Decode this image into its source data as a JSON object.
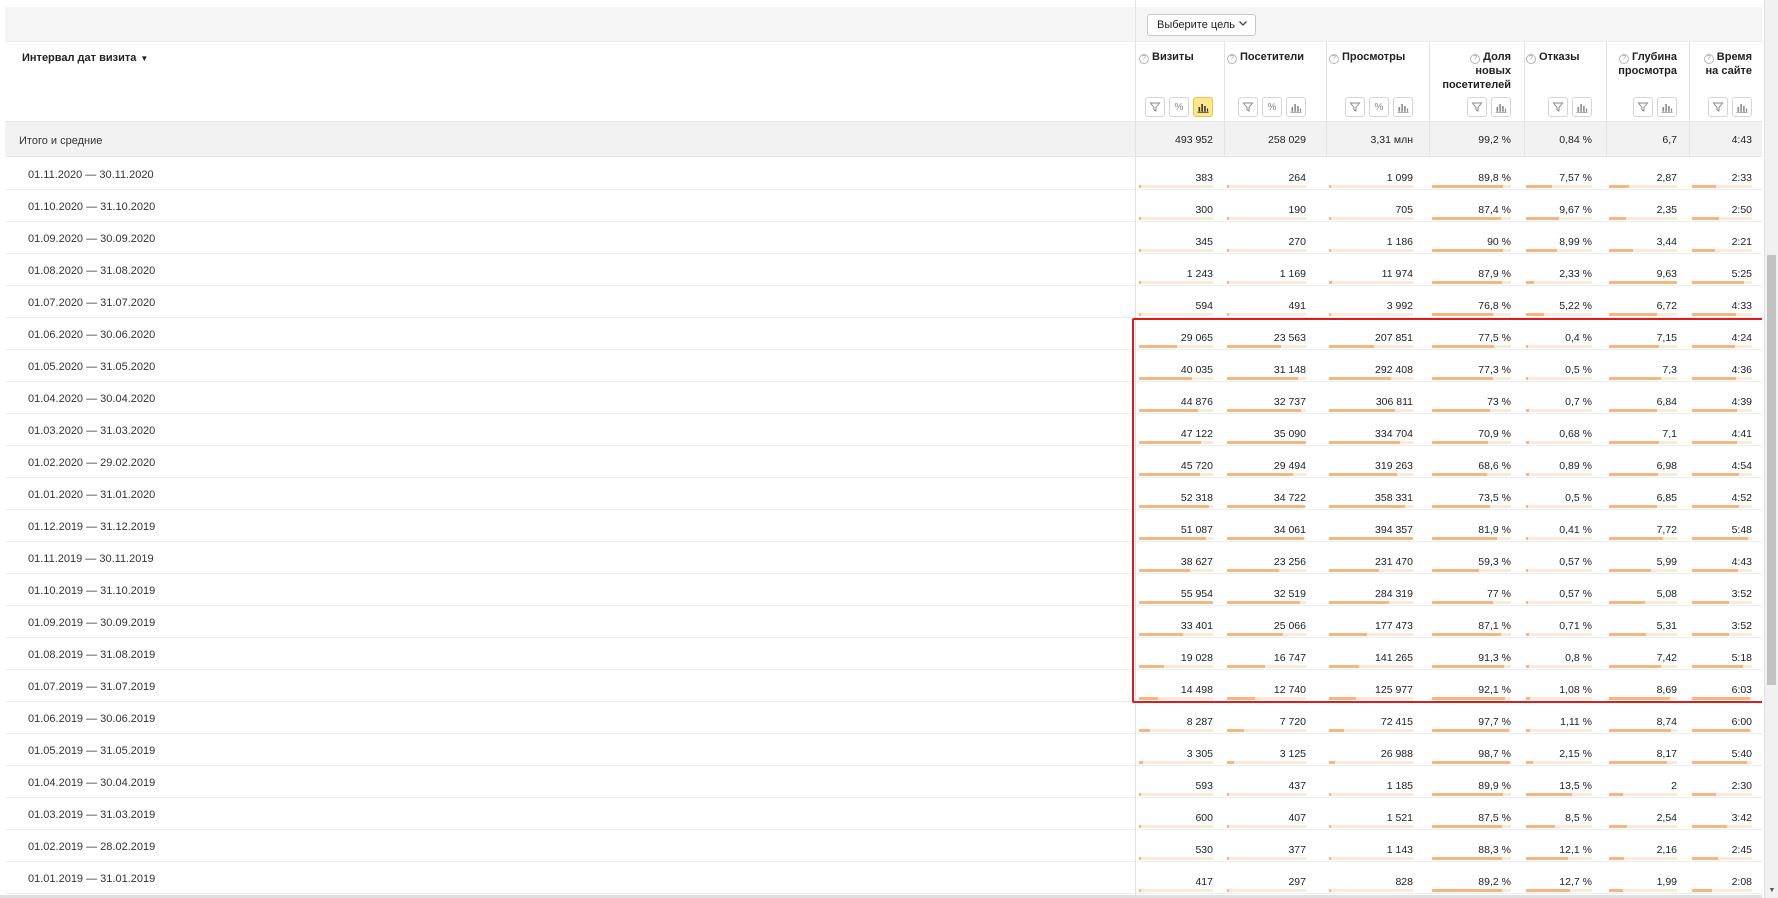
{
  "goal_select": {
    "label": "Выберите цель"
  },
  "header": {
    "dimension_title": "Интервал дат визита",
    "sort_marker": "▼",
    "columns": [
      {
        "key": "visits",
        "lines": [
          "Визиты"
        ],
        "tools": [
          "filter",
          "percent",
          "chart"
        ],
        "chart_active": true
      },
      {
        "key": "visitors",
        "lines": [
          "Посетители"
        ],
        "tools": [
          "filter",
          "percent",
          "chart"
        ],
        "chart_active": false
      },
      {
        "key": "views",
        "lines": [
          "Просмотры"
        ],
        "tools": [
          "filter",
          "percent",
          "chart"
        ],
        "chart_active": false
      },
      {
        "key": "new_share",
        "lines": [
          "Доля",
          "новых",
          "посетителей"
        ],
        "tools": [
          "filter",
          "chart"
        ],
        "chart_active": false
      },
      {
        "key": "bounces",
        "lines": [
          "Отказы"
        ],
        "tools": [
          "filter",
          "chart"
        ],
        "chart_active": false
      },
      {
        "key": "depth",
        "lines": [
          "Глубина",
          "просмотра"
        ],
        "tools": [
          "filter",
          "chart"
        ],
        "chart_active": false
      },
      {
        "key": "time",
        "lines": [
          "Время",
          "на сайте"
        ],
        "tools": [
          "filter",
          "chart"
        ],
        "chart_active": false
      }
    ]
  },
  "totals": {
    "label": "Итого и средние",
    "values": [
      "493 952",
      "258 029",
      "3,31 млн",
      "99,2 %",
      "0,84 %",
      "6,7",
      "4:43"
    ]
  },
  "rows": [
    {
      "period": "01.11.2020 — 30.11.2020",
      "values": [
        "383",
        "264",
        "1 099",
        "89,8 %",
        "7,57 %",
        "2,87",
        "2:33"
      ],
      "bars": [
        0.01,
        0.01,
        0.01,
        0.9,
        0.4,
        0.3,
        0.4
      ]
    },
    {
      "period": "01.10.2020 — 31.10.2020",
      "values": [
        "300",
        "190",
        "705",
        "87,4 %",
        "9,67 %",
        "2,35",
        "2:50"
      ],
      "bars": [
        0.01,
        0.01,
        0.01,
        0.87,
        0.5,
        0.25,
        0.45
      ]
    },
    {
      "period": "01.09.2020 — 30.09.2020",
      "values": [
        "345",
        "270",
        "1 186",
        "90 %",
        "8,99 %",
        "3,44",
        "2:21"
      ],
      "bars": [
        0.01,
        0.01,
        0.01,
        0.9,
        0.47,
        0.36,
        0.38
      ]
    },
    {
      "period": "01.08.2020 — 31.08.2020",
      "values": [
        "1 243",
        "1 169",
        "11 974",
        "87,9 %",
        "2,33 %",
        "9,63",
        "5:25"
      ],
      "bars": [
        0.02,
        0.03,
        0.03,
        0.88,
        0.12,
        1.0,
        0.87
      ]
    },
    {
      "period": "01.07.2020 — 31.07.2020",
      "values": [
        "594",
        "491",
        "3 992",
        "76,8 %",
        "5,22 %",
        "6,72",
        "4:33"
      ],
      "bars": [
        0.01,
        0.01,
        0.01,
        0.77,
        0.28,
        0.7,
        0.73
      ]
    },
    {
      "period": "01.06.2020 — 30.06.2020",
      "values": [
        "29 065",
        "23 563",
        "207 851",
        "77,5 %",
        "0,4 %",
        "7,15",
        "4:24"
      ],
      "bars": [
        0.52,
        0.68,
        0.53,
        0.78,
        0.02,
        0.74,
        0.71
      ]
    },
    {
      "period": "01.05.2020 — 31.05.2020",
      "values": [
        "40 035",
        "31 148",
        "292 408",
        "77,3 %",
        "0,5 %",
        "7,3",
        "4:36"
      ],
      "bars": [
        0.72,
        0.9,
        0.74,
        0.77,
        0.03,
        0.76,
        0.74
      ]
    },
    {
      "period": "01.04.2020 — 30.04.2020",
      "values": [
        "44 876",
        "32 737",
        "306 811",
        "73 %",
        "0,7 %",
        "6,84",
        "4:39"
      ],
      "bars": [
        0.8,
        0.94,
        0.78,
        0.73,
        0.04,
        0.71,
        0.75
      ]
    },
    {
      "period": "01.03.2020 — 31.03.2020",
      "values": [
        "47 122",
        "35 090",
        "334 704",
        "70,9 %",
        "0,68 %",
        "7,1",
        "4:41"
      ],
      "bars": [
        0.84,
        1.0,
        0.85,
        0.71,
        0.04,
        0.74,
        0.75
      ]
    },
    {
      "period": "01.02.2020 — 29.02.2020",
      "values": [
        "45 720",
        "29 494",
        "319 263",
        "68,6 %",
        "0,89 %",
        "6,98",
        "4:54"
      ],
      "bars": [
        0.82,
        0.84,
        0.81,
        0.69,
        0.05,
        0.72,
        0.79
      ]
    },
    {
      "period": "01.01.2020 — 31.01.2020",
      "values": [
        "52 318",
        "34 722",
        "358 331",
        "73,5 %",
        "0,5 %",
        "6,85",
        "4:52"
      ],
      "bars": [
        0.94,
        0.99,
        0.91,
        0.74,
        0.03,
        0.71,
        0.78
      ]
    },
    {
      "period": "01.12.2019 — 31.12.2019",
      "values": [
        "51 087",
        "34 061",
        "394 357",
        "81,9 %",
        "0,41 %",
        "7,72",
        "5:48"
      ],
      "bars": [
        0.91,
        0.97,
        1.0,
        0.82,
        0.02,
        0.8,
        0.93
      ]
    },
    {
      "period": "01.11.2019 — 30.11.2019",
      "values": [
        "38 627",
        "23 256",
        "231 470",
        "59,3 %",
        "0,57 %",
        "5,99",
        "4:43"
      ],
      "bars": [
        0.69,
        0.66,
        0.59,
        0.59,
        0.03,
        0.62,
        0.76
      ]
    },
    {
      "period": "01.10.2019 — 31.10.2019",
      "values": [
        "55 954",
        "32 519",
        "284 319",
        "77 %",
        "0,57 %",
        "5,08",
        "3:52"
      ],
      "bars": [
        1.0,
        0.93,
        0.72,
        0.77,
        0.03,
        0.53,
        0.62
      ]
    },
    {
      "period": "01.09.2019 — 30.09.2019",
      "values": [
        "33 401",
        "25 066",
        "177 473",
        "87,1 %",
        "0,71 %",
        "5,31",
        "3:52"
      ],
      "bars": [
        0.6,
        0.71,
        0.45,
        0.87,
        0.04,
        0.55,
        0.62
      ]
    },
    {
      "period": "01.08.2019 — 31.08.2019",
      "values": [
        "19 028",
        "16 747",
        "141 265",
        "91,3 %",
        "0,8 %",
        "7,42",
        "5:18"
      ],
      "bars": [
        0.34,
        0.48,
        0.36,
        0.91,
        0.04,
        0.77,
        0.85
      ]
    },
    {
      "period": "01.07.2019 — 31.07.2019",
      "values": [
        "14 498",
        "12 740",
        "125 977",
        "92,1 %",
        "1,08 %",
        "8,69",
        "6:03"
      ],
      "bars": [
        0.26,
        0.36,
        0.32,
        0.92,
        0.06,
        0.9,
        0.97
      ]
    },
    {
      "period": "01.06.2019 — 30.06.2019",
      "values": [
        "8 287",
        "7 720",
        "72 415",
        "97,7 %",
        "1,11 %",
        "8,74",
        "6:00"
      ],
      "bars": [
        0.15,
        0.22,
        0.18,
        0.98,
        0.06,
        0.91,
        0.96
      ]
    },
    {
      "period": "01.05.2019 — 31.05.2019",
      "values": [
        "3 305",
        "3 125",
        "26 988",
        "98,7 %",
        "2,15 %",
        "8,17",
        "5:40"
      ],
      "bars": [
        0.06,
        0.09,
        0.07,
        0.99,
        0.11,
        0.85,
        0.91
      ]
    },
    {
      "period": "01.04.2019 — 30.04.2019",
      "values": [
        "593",
        "437",
        "1 185",
        "89,9 %",
        "13,5 %",
        "2",
        "2:30"
      ],
      "bars": [
        0.01,
        0.01,
        0.01,
        0.9,
        0.7,
        0.21,
        0.4
      ]
    },
    {
      "period": "01.03.2019 — 31.03.2019",
      "values": [
        "600",
        "407",
        "1 521",
        "87,5 %",
        "8,5 %",
        "2,54",
        "3:42"
      ],
      "bars": [
        0.01,
        0.01,
        0.01,
        0.88,
        0.44,
        0.26,
        0.59
      ]
    },
    {
      "period": "01.02.2019 — 28.02.2019",
      "values": [
        "530",
        "377",
        "1 143",
        "88,3 %",
        "12,1 %",
        "2,16",
        "2:45"
      ],
      "bars": [
        0.01,
        0.01,
        0.01,
        0.88,
        0.63,
        0.22,
        0.44
      ]
    },
    {
      "period": "01.01.2019 — 31.01.2019",
      "values": [
        "417",
        "297",
        "828",
        "89,2 %",
        "12,7 %",
        "1,99",
        "2:08"
      ],
      "bars": [
        0.01,
        0.01,
        0.01,
        0.89,
        0.66,
        0.21,
        0.34
      ]
    }
  ],
  "colors": {
    "bar_fill": "#f5b780",
    "bar_track": "#faebd9",
    "highlight_border": "#e01b1b",
    "active_tool": "#fde78b"
  }
}
